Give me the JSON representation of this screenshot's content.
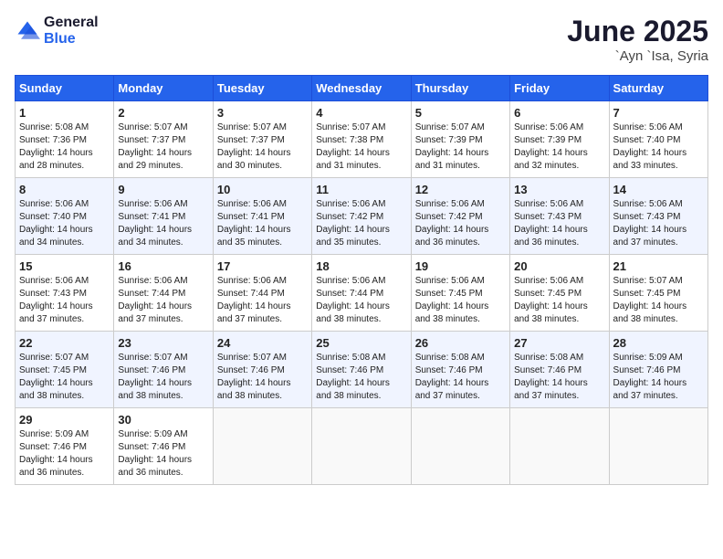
{
  "logo": {
    "general": "General",
    "blue": "Blue"
  },
  "title": {
    "month": "June 2025",
    "location": "`Ayn `Isa, Syria"
  },
  "weekdays": [
    "Sunday",
    "Monday",
    "Tuesday",
    "Wednesday",
    "Thursday",
    "Friday",
    "Saturday"
  ],
  "weeks": [
    [
      {
        "day": "1",
        "sunrise": "5:08 AM",
        "sunset": "7:36 PM",
        "daylight": "14 hours and 28 minutes."
      },
      {
        "day": "2",
        "sunrise": "5:07 AM",
        "sunset": "7:37 PM",
        "daylight": "14 hours and 29 minutes."
      },
      {
        "day": "3",
        "sunrise": "5:07 AM",
        "sunset": "7:37 PM",
        "daylight": "14 hours and 30 minutes."
      },
      {
        "day": "4",
        "sunrise": "5:07 AM",
        "sunset": "7:38 PM",
        "daylight": "14 hours and 31 minutes."
      },
      {
        "day": "5",
        "sunrise": "5:07 AM",
        "sunset": "7:39 PM",
        "daylight": "14 hours and 31 minutes."
      },
      {
        "day": "6",
        "sunrise": "5:06 AM",
        "sunset": "7:39 PM",
        "daylight": "14 hours and 32 minutes."
      },
      {
        "day": "7",
        "sunrise": "5:06 AM",
        "sunset": "7:40 PM",
        "daylight": "14 hours and 33 minutes."
      }
    ],
    [
      {
        "day": "8",
        "sunrise": "5:06 AM",
        "sunset": "7:40 PM",
        "daylight": "14 hours and 34 minutes."
      },
      {
        "day": "9",
        "sunrise": "5:06 AM",
        "sunset": "7:41 PM",
        "daylight": "14 hours and 34 minutes."
      },
      {
        "day": "10",
        "sunrise": "5:06 AM",
        "sunset": "7:41 PM",
        "daylight": "14 hours and 35 minutes."
      },
      {
        "day": "11",
        "sunrise": "5:06 AM",
        "sunset": "7:42 PM",
        "daylight": "14 hours and 35 minutes."
      },
      {
        "day": "12",
        "sunrise": "5:06 AM",
        "sunset": "7:42 PM",
        "daylight": "14 hours and 36 minutes."
      },
      {
        "day": "13",
        "sunrise": "5:06 AM",
        "sunset": "7:43 PM",
        "daylight": "14 hours and 36 minutes."
      },
      {
        "day": "14",
        "sunrise": "5:06 AM",
        "sunset": "7:43 PM",
        "daylight": "14 hours and 37 minutes."
      }
    ],
    [
      {
        "day": "15",
        "sunrise": "5:06 AM",
        "sunset": "7:43 PM",
        "daylight": "14 hours and 37 minutes."
      },
      {
        "day": "16",
        "sunrise": "5:06 AM",
        "sunset": "7:44 PM",
        "daylight": "14 hours and 37 minutes."
      },
      {
        "day": "17",
        "sunrise": "5:06 AM",
        "sunset": "7:44 PM",
        "daylight": "14 hours and 37 minutes."
      },
      {
        "day": "18",
        "sunrise": "5:06 AM",
        "sunset": "7:44 PM",
        "daylight": "14 hours and 38 minutes."
      },
      {
        "day": "19",
        "sunrise": "5:06 AM",
        "sunset": "7:45 PM",
        "daylight": "14 hours and 38 minutes."
      },
      {
        "day": "20",
        "sunrise": "5:06 AM",
        "sunset": "7:45 PM",
        "daylight": "14 hours and 38 minutes."
      },
      {
        "day": "21",
        "sunrise": "5:07 AM",
        "sunset": "7:45 PM",
        "daylight": "14 hours and 38 minutes."
      }
    ],
    [
      {
        "day": "22",
        "sunrise": "5:07 AM",
        "sunset": "7:45 PM",
        "daylight": "14 hours and 38 minutes."
      },
      {
        "day": "23",
        "sunrise": "5:07 AM",
        "sunset": "7:46 PM",
        "daylight": "14 hours and 38 minutes."
      },
      {
        "day": "24",
        "sunrise": "5:07 AM",
        "sunset": "7:46 PM",
        "daylight": "14 hours and 38 minutes."
      },
      {
        "day": "25",
        "sunrise": "5:08 AM",
        "sunset": "7:46 PM",
        "daylight": "14 hours and 38 minutes."
      },
      {
        "day": "26",
        "sunrise": "5:08 AM",
        "sunset": "7:46 PM",
        "daylight": "14 hours and 37 minutes."
      },
      {
        "day": "27",
        "sunrise": "5:08 AM",
        "sunset": "7:46 PM",
        "daylight": "14 hours and 37 minutes."
      },
      {
        "day": "28",
        "sunrise": "5:09 AM",
        "sunset": "7:46 PM",
        "daylight": "14 hours and 37 minutes."
      }
    ],
    [
      {
        "day": "29",
        "sunrise": "5:09 AM",
        "sunset": "7:46 PM",
        "daylight": "14 hours and 36 minutes."
      },
      {
        "day": "30",
        "sunrise": "5:09 AM",
        "sunset": "7:46 PM",
        "daylight": "14 hours and 36 minutes."
      },
      null,
      null,
      null,
      null,
      null
    ]
  ],
  "labels": {
    "sunrise": "Sunrise:",
    "sunset": "Sunset:",
    "daylight": "Daylight:"
  }
}
